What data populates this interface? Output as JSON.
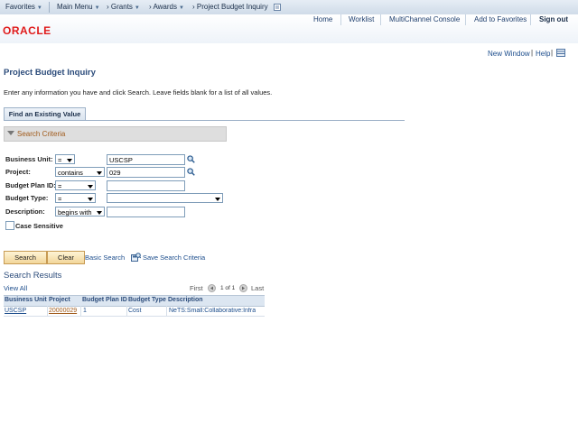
{
  "nav": {
    "favorites": "Favorites",
    "main_menu": "Main Menu",
    "grants": "Grants",
    "awards": "Awards",
    "page": "Project Budget Inquiry"
  },
  "header": {
    "logo": "ORACLE",
    "links": [
      "Home",
      "Worklist",
      "MultiChannel Console",
      "Add to Favorites",
      "Sign out"
    ]
  },
  "page_links": {
    "new_window": "New Window",
    "help": "Help"
  },
  "title": "Project Budget Inquiry",
  "instructions": "Enter any information you have and click Search. Leave fields blank for a list of all values.",
  "tab": "Find an Existing Value",
  "criteria_header": "Search Criteria",
  "fields": {
    "business_unit": {
      "label": "Business Unit:",
      "op": "=",
      "value": "USCSP"
    },
    "project": {
      "label": "Project:",
      "op": "contains",
      "value": "029"
    },
    "budget_plan_id": {
      "label": "Budget Plan ID:",
      "op": "=",
      "value": ""
    },
    "budget_type": {
      "label": "Budget Type:",
      "op": "=",
      "value": ""
    },
    "description": {
      "label": "Description:",
      "op": "begins with",
      "value": ""
    }
  },
  "case_sensitive": "Case Sensitive",
  "buttons": {
    "search": "Search",
    "clear": "Clear",
    "basic_search": "Basic Search",
    "save_criteria": "Save Search Criteria"
  },
  "results": {
    "title": "Search Results",
    "view_all": "View All",
    "first": "First",
    "page_of": "1 of 1",
    "last": "Last",
    "columns": [
      "Business Unit",
      "Project",
      "Budget Plan ID",
      "Budget Type",
      "Description"
    ],
    "rows": [
      [
        "USCSP",
        "20000029",
        "1",
        "Cost",
        "NeTS:Small:Collaborative:Infra"
      ]
    ]
  }
}
